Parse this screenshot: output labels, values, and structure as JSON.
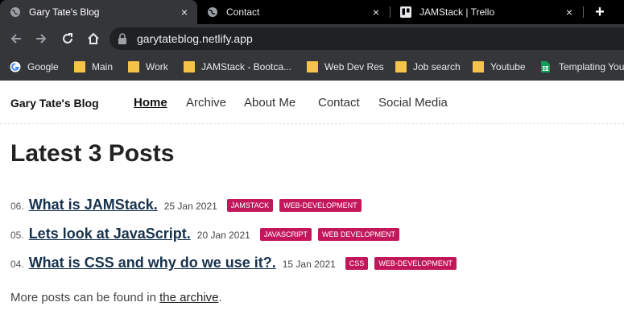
{
  "browser": {
    "tabs": [
      {
        "title": "Gary Tate's Blog",
        "icon": "globe-icon",
        "active": true
      },
      {
        "title": "Contact",
        "icon": "globe-icon",
        "active": false
      },
      {
        "title": "JAMStack | Trello",
        "icon": "trello-icon",
        "active": false
      }
    ],
    "close_glyph": "×",
    "new_tab_glyph": "+",
    "url": "garytateblog.netlify.app",
    "bookmarks": [
      {
        "label": "Google",
        "icon": "google-icon"
      },
      {
        "label": "Main",
        "icon": "folder-icon"
      },
      {
        "label": "Work",
        "icon": "folder-icon"
      },
      {
        "label": "JAMStack - Bootca...",
        "icon": "folder-icon"
      },
      {
        "label": "Web Dev Res",
        "icon": "folder-icon"
      },
      {
        "label": "Job search",
        "icon": "folder-icon"
      },
      {
        "label": "Youtube",
        "icon": "folder-icon"
      },
      {
        "label": "Templating You",
        "icon": "sheets-icon"
      }
    ],
    "colors": {
      "tabstrip": "#000000",
      "toolbar": "#35363a",
      "omnibox": "#202124"
    }
  },
  "site": {
    "brand": "Gary Tate's Blog",
    "nav": [
      "Home",
      "Archive",
      "About Me",
      "Contact",
      "Social Media"
    ],
    "current_nav": "Home"
  },
  "main": {
    "heading": "Latest 3 Posts",
    "posts": [
      {
        "num": "06.",
        "title": "What is JAMStack.",
        "date": "25 Jan 2021",
        "tags": [
          "JAMSTACK",
          "WEB-DEVELOPMENT"
        ]
      },
      {
        "num": "05.",
        "title": "Lets look at JavaScript.",
        "date": "20 Jan 2021",
        "tags": [
          "JAVASCRIPT",
          "WEB DEVELOPMENT"
        ]
      },
      {
        "num": "04.",
        "title": "What is CSS and why do we use it?.",
        "date": "15 Jan 2021",
        "tags": [
          "CSS",
          "WEB-DEVELOPMENT"
        ]
      }
    ],
    "more_text": "More posts can be found in ",
    "more_link": "the archive",
    "more_suffix": ".",
    "colors": {
      "tag": "#c2185b",
      "post_title": "#17324d"
    }
  }
}
